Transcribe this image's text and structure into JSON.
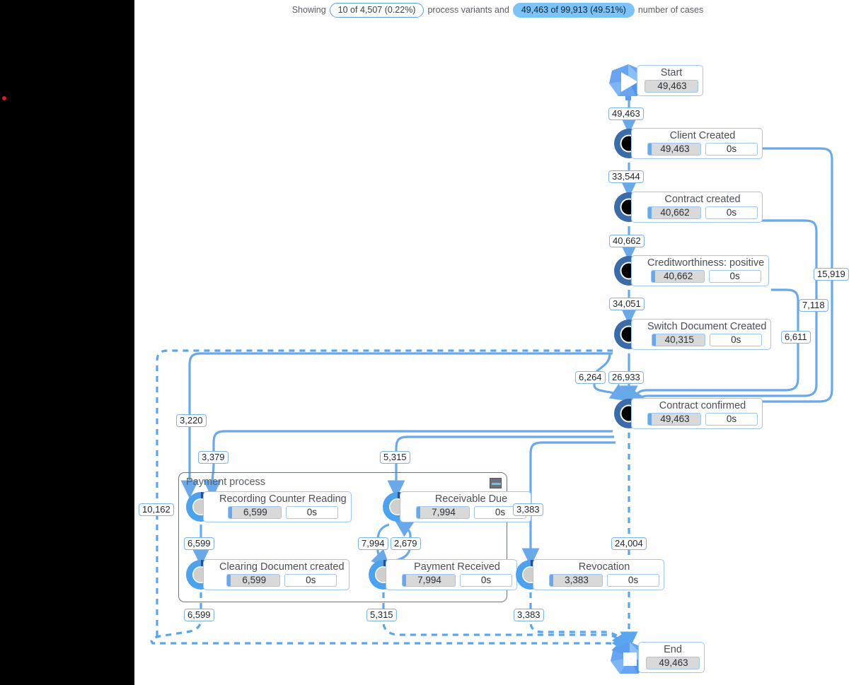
{
  "status": {
    "prefix": "Showing",
    "variants_pill": "10 of 4,507 (0.22%)",
    "middle": "process variants and",
    "cases_pill": "49,463 of 99,913 (49.51%)",
    "suffix": "number of cases"
  },
  "colors": {
    "edge": "#6aa9e9",
    "node_ring_dark": "#3c6ca8",
    "node_ring_light": "#4da2f0",
    "group_border": "#6f757d",
    "accent_highlight": "#7cc3f7",
    "rail": "#000000",
    "rail_dot": "#e8162b"
  },
  "group": {
    "title": "Payment process",
    "collapse_icon": "minimize-icon"
  },
  "terminals": [
    {
      "id": "start",
      "label": "Start",
      "count": "49,463",
      "icon": "start-event-icon"
    },
    {
      "id": "end",
      "label": "End",
      "count": "49,463",
      "icon": "end-event-icon"
    }
  ],
  "nodes": [
    {
      "id": "client_created",
      "label": "Client Created",
      "count": "49,463",
      "duration": "0s",
      "kind": "dark"
    },
    {
      "id": "contract_created",
      "label": "Contract created",
      "count": "40,662",
      "duration": "0s",
      "kind": "dark"
    },
    {
      "id": "creditworthiness",
      "label": "Creditworthiness: positive",
      "count": "40,662",
      "duration": "0s",
      "kind": "dark"
    },
    {
      "id": "switch_document",
      "label": "Switch Document Created",
      "count": "40,315",
      "duration": "0s",
      "kind": "dark"
    },
    {
      "id": "contract_confirmed",
      "label": "Contract confirmed",
      "count": "49,463",
      "duration": "0s",
      "kind": "dark"
    },
    {
      "id": "recording_counter",
      "label": "Recording Counter Reading",
      "count": "6,599",
      "duration": "0s",
      "kind": "light"
    },
    {
      "id": "clearing_document",
      "label": "Clearing Document created",
      "count": "6,599",
      "duration": "0s",
      "kind": "light"
    },
    {
      "id": "receivable_due",
      "label": "Receivable Due",
      "count": "7,994",
      "duration": "0s",
      "kind": "light"
    },
    {
      "id": "payment_received",
      "label": "Payment Received",
      "count": "7,994",
      "duration": "0s",
      "kind": "light"
    },
    {
      "id": "revocation",
      "label": "Revocation",
      "count": "3,383",
      "duration": "0s",
      "kind": "light"
    }
  ],
  "edge_labels": [
    {
      "id": "start_to_client",
      "value": "49,463"
    },
    {
      "id": "client_to_contract",
      "value": "33,544"
    },
    {
      "id": "contract_to_credit",
      "value": "40,662"
    },
    {
      "id": "credit_to_switch",
      "value": "34,051"
    },
    {
      "id": "switch_to_confirmed_left",
      "value": "6,264"
    },
    {
      "id": "switch_to_confirmed",
      "value": "26,933"
    },
    {
      "id": "confirmed_to_client_loop",
      "value": "15,919"
    },
    {
      "id": "confirmed_to_contract_loop",
      "value": "7,118"
    },
    {
      "id": "confirmed_to_credit_loop",
      "value": "6,611"
    },
    {
      "id": "confirmed_to_recording",
      "value": "3,220"
    },
    {
      "id": "switch_to_recording",
      "value": "3,379"
    },
    {
      "id": "confirmed_to_receivable",
      "value": "5,315"
    },
    {
      "id": "confirmed_to_revocation",
      "value": "3,383"
    },
    {
      "id": "confirmed_to_end",
      "value": "24,004"
    },
    {
      "id": "recording_to_clearing",
      "value": "6,599"
    },
    {
      "id": "receivable_to_payment",
      "value": "7,994"
    },
    {
      "id": "payment_to_receivable",
      "value": "2,679"
    },
    {
      "id": "clearing_to_end",
      "value": "6,599"
    },
    {
      "id": "payment_to_end",
      "value": "5,315"
    },
    {
      "id": "revocation_to_end",
      "value": "3,383"
    },
    {
      "id": "clearing_back_to_switch",
      "value": "10,162"
    }
  ]
}
